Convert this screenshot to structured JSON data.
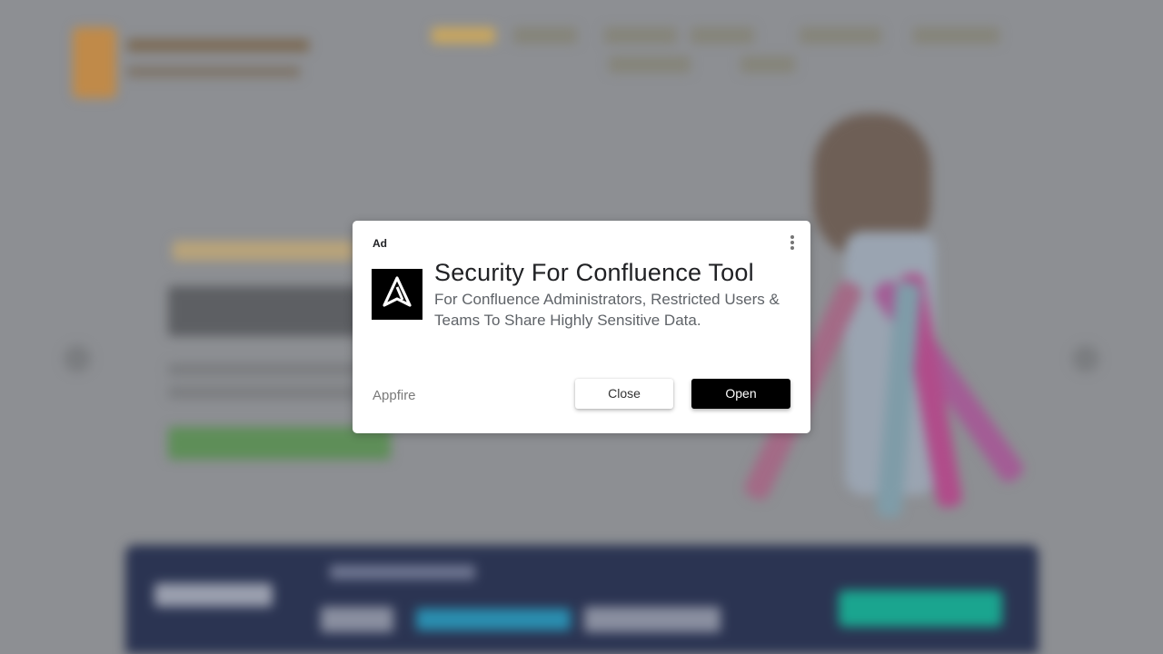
{
  "ad": {
    "label": "Ad",
    "headline": "Security For Confluence Tool",
    "description": "For Confluence Administrators, Restricted Users & Teams To Share Highly Sensitive Data.",
    "advertiser": "Appfire",
    "close_label": "Close",
    "open_label": "Open",
    "menu_icon": "more-vert-icon",
    "logo_icon": "appfire-logo-icon"
  },
  "colors": {
    "overlay": "#8d8f93",
    "open_button_bg": "#000000",
    "close_button_bg": "#ffffff",
    "headline": "#202124",
    "description": "#5f6368"
  }
}
